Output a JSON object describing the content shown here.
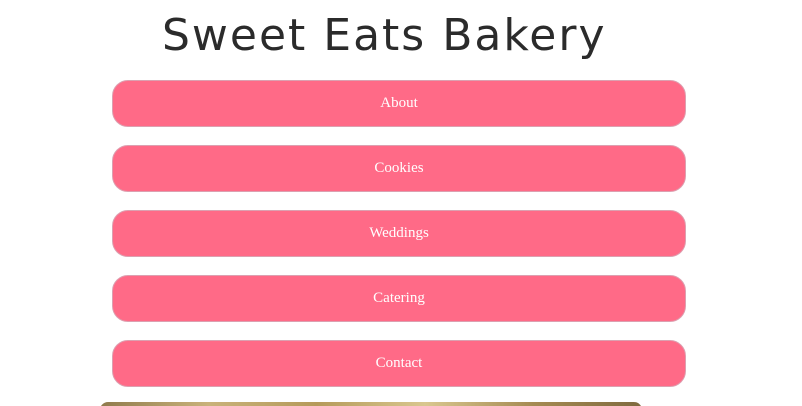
{
  "header": {
    "title": "Sweet Eats Bakery"
  },
  "nav": {
    "items": [
      {
        "label": "About"
      },
      {
        "label": "Cookies"
      },
      {
        "label": "Weddings"
      },
      {
        "label": "Catering"
      },
      {
        "label": "Contact"
      }
    ]
  },
  "colors": {
    "button_bg": "#ff6a87",
    "button_text": "#ffffff",
    "title_text": "#2b2b2b"
  }
}
